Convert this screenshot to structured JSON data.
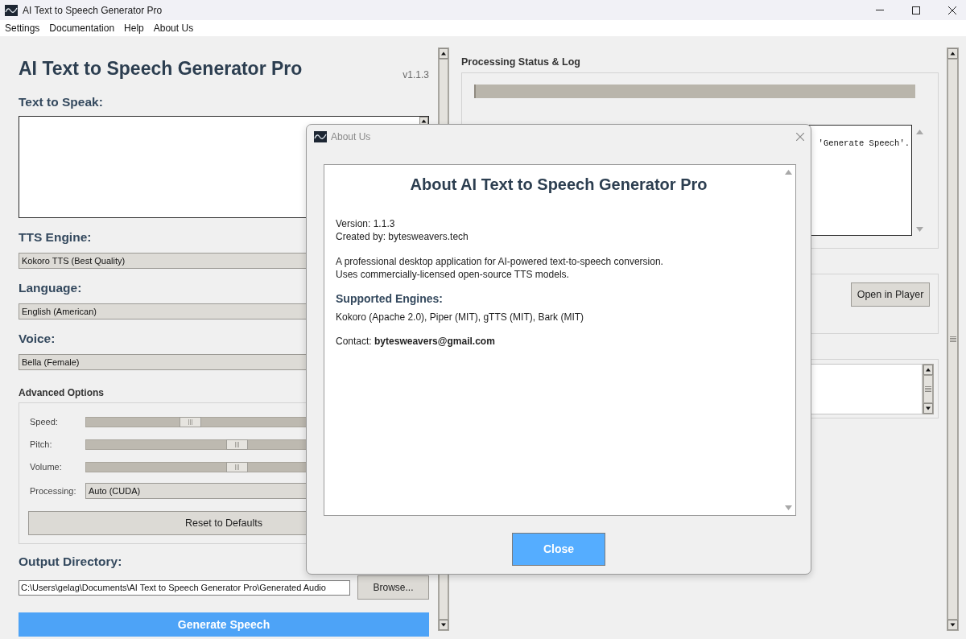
{
  "window": {
    "title": "AI Text to Speech Generator Pro"
  },
  "menu": [
    "Settings",
    "Documentation",
    "Help",
    "About Us"
  ],
  "main": {
    "app_title": "AI Text to Speech Generator Pro",
    "version": "v1.1.3",
    "text_label": "Text to Speak:",
    "selectors": [
      {
        "label": "TTS Engine:",
        "value": "Kokoro TTS (Best Quality)"
      },
      {
        "label": "Language:",
        "value": "English (American)"
      },
      {
        "label": "Voice:",
        "value": "Bella (Female)"
      }
    ],
    "advanced": {
      "title": "Advanced Options",
      "controls": [
        {
          "kind": "slider",
          "label": "Speed:",
          "level": 0.3
        },
        {
          "kind": "slider",
          "label": "Pitch:",
          "level": 0.45
        },
        {
          "kind": "slider",
          "label": "Volume:",
          "level": 0.45
        },
        {
          "kind": "select",
          "label": "Processing:",
          "value": "Auto (CUDA)"
        }
      ],
      "reset_button": "Reset to Defaults"
    },
    "output": {
      "label": "Output Directory:",
      "path": "C:\\Users\\gelag\\Documents\\AI Text to Speech Generator Pro\\Generated Audio",
      "browse_button": "Browse..."
    },
    "generate_button": "Generate Speech"
  },
  "status_panel": {
    "title": "Processing Status & Log",
    "progress": {
      "level": 0
    },
    "log_lines": [
      "'Generate Speech'."
    ],
    "player_button": "Open in Player"
  },
  "about_dialog": {
    "title": "About Us",
    "heading": "About AI Text to Speech Generator Pro",
    "info_lines": [
      "Version: 1.1.3",
      "Created by: bytesweavers.tech"
    ],
    "description_lines": [
      "A professional desktop application for AI-powered text-to-speech conversion.",
      "Uses commercially-licensed open-source TTS models."
    ],
    "engines_heading": "Supported Engines:",
    "engines": "Kokoro (Apache 2.0), Piper (MIT), gTTS (MIT), Bark (MIT)",
    "contact": "Contact: **bytesweavers@gmail.com**",
    "close_button": "Close"
  }
}
